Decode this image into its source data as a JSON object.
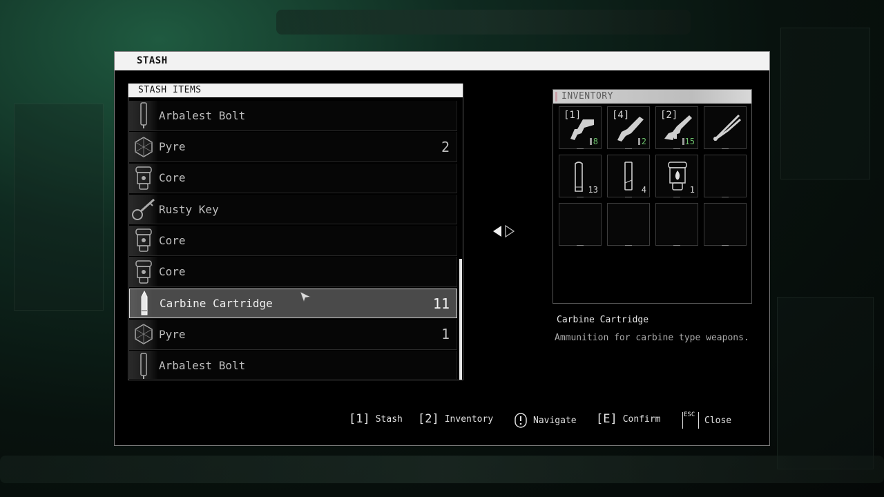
{
  "window": {
    "title": "STASH"
  },
  "stash": {
    "header": "STASH ITEMS",
    "items": [
      {
        "name": "Arbalest Bolt",
        "qty": "",
        "icon": "bolt-icon",
        "selected": false
      },
      {
        "name": "Pyre",
        "qty": "2",
        "icon": "pyre-icon",
        "selected": false
      },
      {
        "name": "Core",
        "qty": "",
        "icon": "core-icon",
        "selected": false
      },
      {
        "name": "Rusty Key",
        "qty": "",
        "icon": "key-icon",
        "selected": false
      },
      {
        "name": "Core",
        "qty": "",
        "icon": "core-icon",
        "selected": false
      },
      {
        "name": "Core",
        "qty": "",
        "icon": "core-icon",
        "selected": false
      },
      {
        "name": "Carbine Cartridge",
        "qty": "11",
        "icon": "cartridge-icon",
        "selected": true
      },
      {
        "name": "Pyre",
        "qty": "1",
        "icon": "pyre-icon",
        "selected": false
      },
      {
        "name": "Arbalest Bolt",
        "qty": "",
        "icon": "bolt-icon",
        "selected": false
      }
    ]
  },
  "inventory": {
    "header": "INVENTORY",
    "slots": [
      {
        "key": "[1]",
        "count": "8",
        "count_color": "green",
        "icon": "handgun-icon"
      },
      {
        "key": "[4]",
        "count": "2",
        "count_color": "green",
        "icon": "shotgun-icon"
      },
      {
        "key": "[2]",
        "count": "15",
        "count_color": "green",
        "icon": "carbine-icon"
      },
      {
        "key": "",
        "count": "",
        "count_color": "",
        "icon": "cutters-icon"
      },
      {
        "key": "",
        "count": "13",
        "count_color": "white",
        "icon": "cartridge-icon"
      },
      {
        "key": "",
        "count": "4",
        "count_color": "white",
        "icon": "bolt-icon"
      },
      {
        "key": "",
        "count": "1",
        "count_color": "white",
        "icon": "fuel-flame-icon"
      },
      {
        "key": "",
        "count": "",
        "count_color": "",
        "icon": ""
      },
      {
        "key": "",
        "count": "",
        "count_color": "",
        "icon": ""
      },
      {
        "key": "",
        "count": "",
        "count_color": "",
        "icon": ""
      },
      {
        "key": "",
        "count": "",
        "count_color": "",
        "icon": ""
      },
      {
        "key": "",
        "count": "",
        "count_color": "",
        "icon": ""
      }
    ]
  },
  "description": {
    "title": "Carbine Cartridge",
    "text": "Ammunition for carbine type weapons."
  },
  "footer": {
    "hints": [
      {
        "key": "[1]",
        "label": "Stash"
      },
      {
        "key": "[2]",
        "label": "Inventory"
      },
      {
        "key": "",
        "label": "Navigate",
        "icon": "navigate-icon"
      },
      {
        "key": "[E]",
        "label": "Confirm"
      },
      {
        "key": "ESC",
        "label": "Close"
      }
    ]
  },
  "colors": {
    "accent_green": "#6cc26c",
    "header_bg": "#f2f2f2",
    "selected_row": "#4a4a4a"
  }
}
